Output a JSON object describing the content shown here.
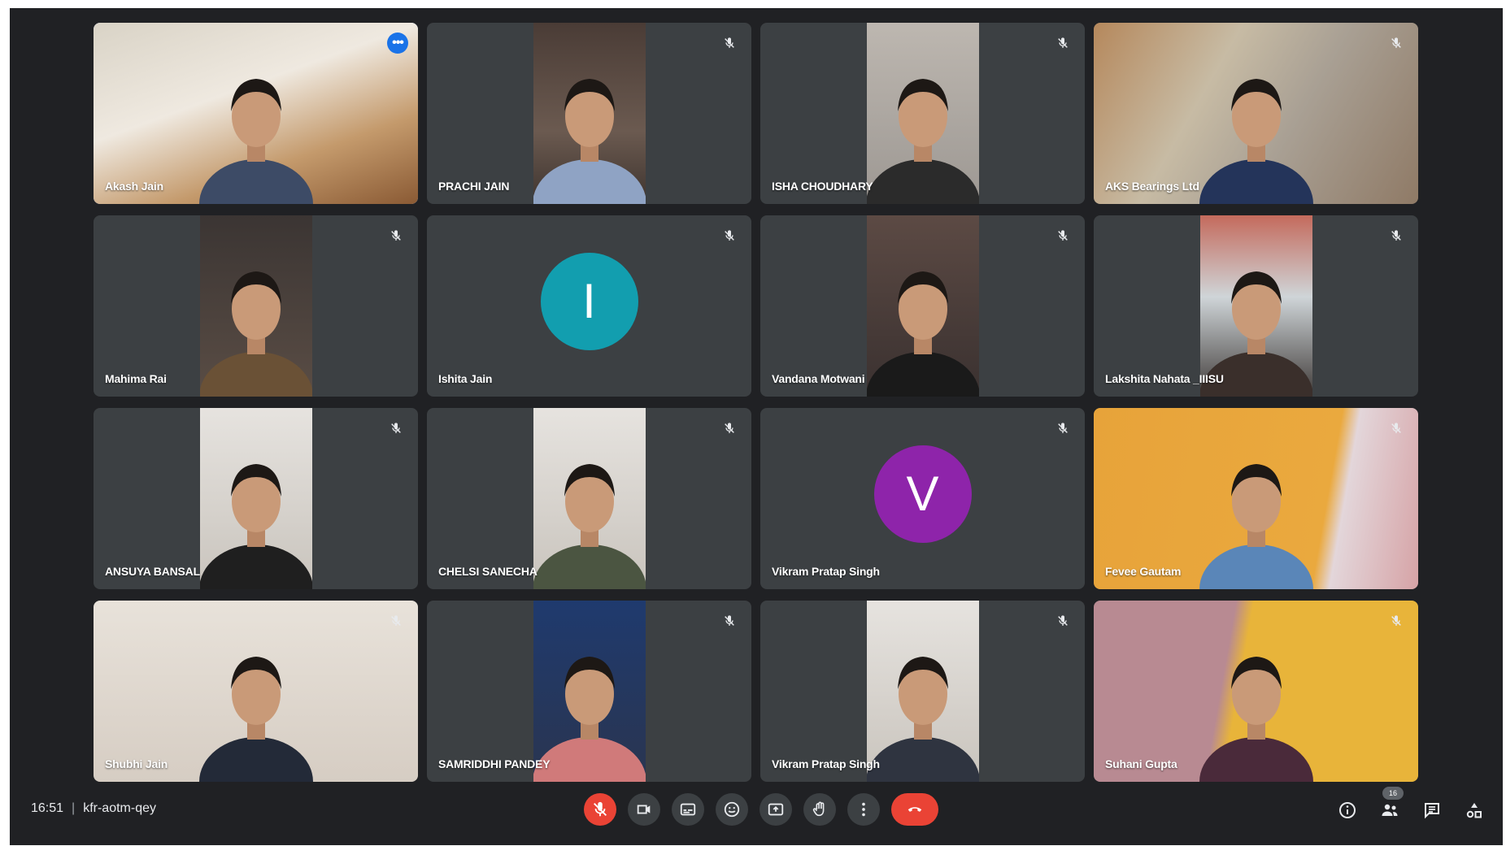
{
  "participants": [
    {
      "name": "Akash Jain",
      "mic": "on",
      "kind": "video",
      "bg": "room-light"
    },
    {
      "name": "PRACHI JAIN",
      "mic": "off",
      "kind": "video-center",
      "bg": "dark-door"
    },
    {
      "name": "ISHA CHOUDHARY",
      "mic": "off",
      "kind": "video-center",
      "bg": "light-grey"
    },
    {
      "name": "AKS Bearings Ltd",
      "mic": "off",
      "kind": "video",
      "bg": "blurred-office"
    },
    {
      "name": "Mahima Rai",
      "mic": "off",
      "kind": "video-center",
      "bg": "dim-room"
    },
    {
      "name": "Ishita Jain",
      "mic": "off",
      "kind": "avatar",
      "initial": "I",
      "avatar_color": "#129eaf"
    },
    {
      "name": "Vandana Motwani",
      "mic": "off",
      "kind": "video-center",
      "bg": "dark-room"
    },
    {
      "name": "Lakshita Nahata _IIISU",
      "mic": "off",
      "kind": "video-center",
      "bg": "shelf"
    },
    {
      "name": "ANSUYA BANSAL",
      "mic": "off",
      "kind": "video-center",
      "bg": "white-wall"
    },
    {
      "name": "CHELSI SANECHA",
      "mic": "off",
      "kind": "video-center",
      "bg": "white-wall"
    },
    {
      "name": "Vikram Pratap Singh",
      "mic": "off",
      "kind": "avatar",
      "initial": "V",
      "avatar_color": "#8e24aa"
    },
    {
      "name": "Fevee Gautam",
      "mic": "off",
      "kind": "video",
      "bg": "yellow-wall"
    },
    {
      "name": "Shubhi Jain",
      "mic": "off",
      "kind": "video",
      "bg": "beige-wall"
    },
    {
      "name": "SAMRIDDHI PANDEY",
      "mic": "off",
      "kind": "video-center",
      "bg": "navy-poster"
    },
    {
      "name": "Vikram Pratap Singh",
      "mic": "off",
      "kind": "video-center",
      "bg": "white-wall"
    },
    {
      "name": "Suhani Gupta",
      "mic": "off",
      "kind": "video",
      "bg": "pink-yellow"
    }
  ],
  "meeting": {
    "time": "16:51",
    "separator": "|",
    "code": "kfr-aotm-qey",
    "people_count": "16"
  },
  "colors": {
    "stage_bg": "#202124",
    "tile_bg": "#3c4043",
    "active_outline": "#8ab4f8",
    "end_call": "#ea4335"
  },
  "controls": [
    "mic-off-icon",
    "camera-icon",
    "captions-icon",
    "emoji-icon",
    "present-icon",
    "raise-hand-icon",
    "more-options-icon",
    "end-call-icon"
  ],
  "right_controls": [
    "info-icon",
    "people-icon",
    "chat-icon",
    "activities-icon"
  ]
}
